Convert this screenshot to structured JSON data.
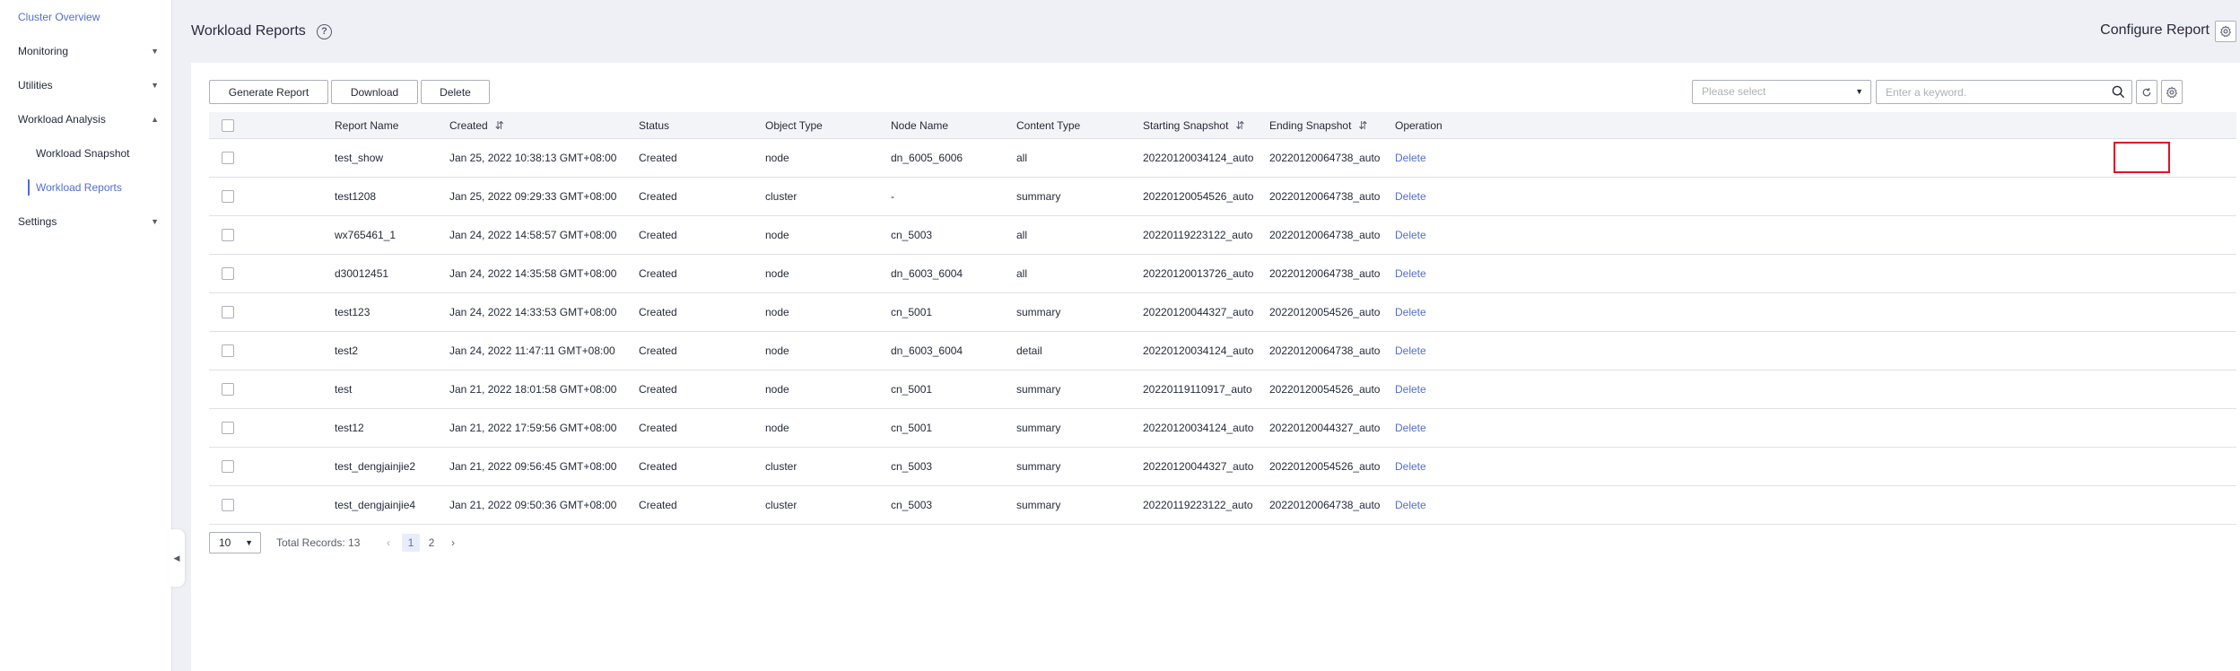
{
  "sidebar": {
    "items": [
      {
        "label": "Cluster Overview",
        "active": true,
        "caret": ""
      },
      {
        "label": "Monitoring",
        "caret": "▼"
      },
      {
        "label": "Utilities",
        "caret": "▼"
      },
      {
        "label": "Workload Analysis",
        "caret": "▲"
      }
    ],
    "sub_items": [
      {
        "label": "Workload Snapshot"
      },
      {
        "label": "Workload Reports",
        "active": true
      }
    ],
    "settings": {
      "label": "Settings",
      "caret": "▼"
    },
    "collapse_icon": "collapse-arrow-icon"
  },
  "header": {
    "title": "Workload Reports",
    "help_icon": "?",
    "configure_label": "Configure Report",
    "configure_icon": "gear-icon"
  },
  "toolbar": {
    "generate_label": "Generate Report",
    "download_label": "Download",
    "delete_label": "Delete",
    "select_placeholder": "Please select",
    "search_placeholder": "Enter a keyword."
  },
  "table": {
    "columns": [
      "Report Name",
      "Created",
      "Status",
      "Object Type",
      "Node Name",
      "Content Type",
      "Starting Snapshot",
      "Ending Snapshot",
      "Operation"
    ],
    "sort_icon": "⇵",
    "rows": [
      {
        "name": "test_show",
        "created": "Jan 25, 2022 10:38:13 GMT+08:00",
        "status": "Created",
        "object_type": "node",
        "node_name": "dn_6005_6006",
        "content_type": "all",
        "start": "20220120034124_auto",
        "end": "20220120064738_auto",
        "op": "Delete"
      },
      {
        "name": "test1208",
        "created": "Jan 25, 2022 09:29:33 GMT+08:00",
        "status": "Created",
        "object_type": "cluster",
        "node_name": "-",
        "content_type": "summary",
        "start": "20220120054526_auto",
        "end": "20220120064738_auto",
        "op": "Delete"
      },
      {
        "name": "wx765461_1",
        "created": "Jan 24, 2022 14:58:57 GMT+08:00",
        "status": "Created",
        "object_type": "node",
        "node_name": "cn_5003",
        "content_type": "all",
        "start": "20220119223122_auto",
        "end": "20220120064738_auto",
        "op": "Delete"
      },
      {
        "name": "d30012451",
        "created": "Jan 24, 2022 14:35:58 GMT+08:00",
        "status": "Created",
        "object_type": "node",
        "node_name": "dn_6003_6004",
        "content_type": "all",
        "start": "20220120013726_auto",
        "end": "20220120064738_auto",
        "op": "Delete"
      },
      {
        "name": "test123",
        "created": "Jan 24, 2022 14:33:53 GMT+08:00",
        "status": "Created",
        "object_type": "node",
        "node_name": "cn_5001",
        "content_type": "summary",
        "start": "20220120044327_auto",
        "end": "20220120054526_auto",
        "op": "Delete"
      },
      {
        "name": "test2",
        "created": "Jan 24, 2022 11:47:11 GMT+08:00",
        "status": "Created",
        "object_type": "node",
        "node_name": "dn_6003_6004",
        "content_type": "detail",
        "start": "20220120034124_auto",
        "end": "20220120064738_auto",
        "op": "Delete"
      },
      {
        "name": "test",
        "created": "Jan 21, 2022 18:01:58 GMT+08:00",
        "status": "Created",
        "object_type": "node",
        "node_name": "cn_5001",
        "content_type": "summary",
        "start": "20220119110917_auto",
        "end": "20220120054526_auto",
        "op": "Delete"
      },
      {
        "name": "test12",
        "created": "Jan 21, 2022 17:59:56 GMT+08:00",
        "status": "Created",
        "object_type": "node",
        "node_name": "cn_5001",
        "content_type": "summary",
        "start": "20220120034124_auto",
        "end": "20220120044327_auto",
        "op": "Delete"
      },
      {
        "name": "test_dengjainjie2",
        "created": "Jan 21, 2022 09:56:45 GMT+08:00",
        "status": "Created",
        "object_type": "cluster",
        "node_name": "cn_5003",
        "content_type": "summary",
        "start": "20220120044327_auto",
        "end": "20220120054526_auto",
        "op": "Delete"
      },
      {
        "name": "test_dengjainjie4",
        "created": "Jan 21, 2022 09:50:36 GMT+08:00",
        "status": "Created",
        "object_type": "cluster",
        "node_name": "cn_5003",
        "content_type": "summary",
        "start": "20220119223122_auto",
        "end": "20220120064738_auto",
        "op": "Delete"
      }
    ]
  },
  "pagination": {
    "page_size": "10",
    "total_label": "Total Records: 13",
    "prev": "‹",
    "pages": [
      "1",
      "2"
    ],
    "next": "›"
  },
  "colors": {
    "accent": "#526ecc",
    "highlight": "#e30e25"
  }
}
